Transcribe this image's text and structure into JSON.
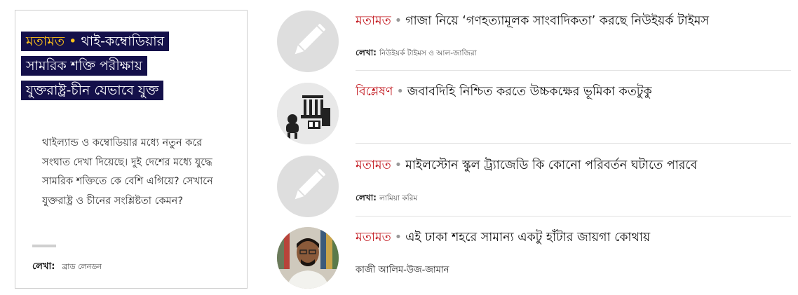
{
  "featured": {
    "kicker": "মতামত",
    "dot": "•",
    "headline_lines": [
      "থাই-কম্বোডিয়ার",
      "সামরিক শক্তি পরীক্ষায়",
      "যুক্তরাষ্ট্র-চীন যেভাবে যুক্ত"
    ],
    "summary": "থাইল্যান্ড ও কম্বোডিয়ার মধ্যে নতুন করে সংঘাত দেখা দিয়েছে। দুই দেশের মধ্যে যুদ্ধে সামরিক শক্তিতে কে বেশি এগিয়ে? সেখানে যুক্তরাষ্ট্র ও চীনের সংশ্লিষ্টতা কেমন?",
    "byline_label": "লেখা:",
    "author": "ব্রাড লেনডন"
  },
  "items": [
    {
      "kicker": "মতামত",
      "dot": "•",
      "title": "গাজা নিয়ে ‘গণহত্যামূলক সাংবাদিকতা’ করছে নিউইয়র্ক টাইমস",
      "byline_label": "লেখা:",
      "author": "নিউইয়র্ক টাইমস ও আল-জাজিরা",
      "thumb_icon": "pencil-icon"
    },
    {
      "kicker": "বিশ্লেষণ",
      "dot": "•",
      "title": "জবাবদিহি নিশ্চিত করতে উচ্চকক্ষের ভূমিকা কতটুকু",
      "thumb_icon": "courthouse-illustration"
    },
    {
      "kicker": "মতামত",
      "dot": "•",
      "title": "মাইলস্টোন স্কুল ট্র্যাজেডি কি কোনো পরিবর্তন ঘটাতে পারবে",
      "byline_label": "লেখা:",
      "author": "লামিয়া করিম",
      "thumb_icon": "pencil-icon"
    },
    {
      "kicker": "মতামত",
      "dot": "•",
      "title": "এই ঢাকা শহরে সামান্য একটু হাঁটার জায়গা কোথায়",
      "author": "কাজী আলিম-উজ-জামান",
      "thumb_icon": "author-photo"
    }
  ],
  "colors": {
    "feature_headline_bg": "#14104a",
    "feature_kicker": "#ffc21a",
    "kicker_red": "#c1141b",
    "thumb_bg": "#dedede"
  }
}
